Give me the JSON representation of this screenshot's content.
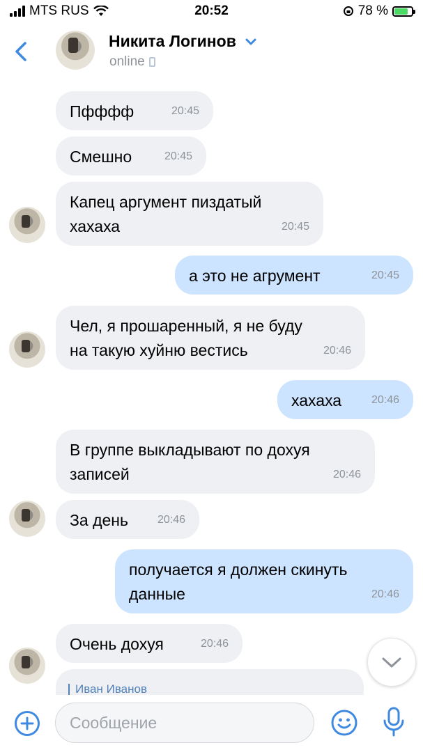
{
  "status_bar": {
    "carrier": "MTS RUS",
    "time": "20:52",
    "battery": "78 %",
    "battery_level": 0.78
  },
  "header": {
    "back_icon": "chevron-left-icon",
    "name": "Никита Логинов",
    "status": "online"
  },
  "messages": [
    {
      "dir": "in",
      "text": "Пфффф",
      "time": "20:45",
      "avatar": false
    },
    {
      "dir": "in",
      "text": "Смешно",
      "time": "20:45",
      "avatar": false
    },
    {
      "dir": "in",
      "text": "Капец аргумент пиздатый\nхахаха",
      "time": "20:45",
      "avatar": true
    },
    {
      "dir": "out",
      "text": "а это не агрумент",
      "time": "20:45"
    },
    {
      "dir": "in",
      "text": "Чел, я прошаренный, я не буду\nна такую хуйню вестись",
      "time": "20:46",
      "avatar": true
    },
    {
      "dir": "out",
      "text": "хахаха",
      "time": "20:46"
    },
    {
      "dir": "in",
      "text": "В группе выкладывают по дохуя\nзаписей",
      "time": "20:46",
      "avatar": false
    },
    {
      "dir": "in",
      "text": "За день",
      "time": "20:46",
      "avatar": true
    },
    {
      "dir": "out",
      "text": "получается я должен скинуть\nданные",
      "time": "20:46"
    },
    {
      "dir": "in",
      "text": "Очень дохуя",
      "time": "20:46",
      "avatar": true
    }
  ],
  "forwarded": {
    "author": "Иван Иванов"
  },
  "input": {
    "placeholder": "Сообщение"
  },
  "colors": {
    "incoming_bubble": "#eef0f3",
    "outgoing_bubble": "#cce4ff",
    "accent": "#3f8ae0",
    "time_gray": "#8e9399"
  }
}
